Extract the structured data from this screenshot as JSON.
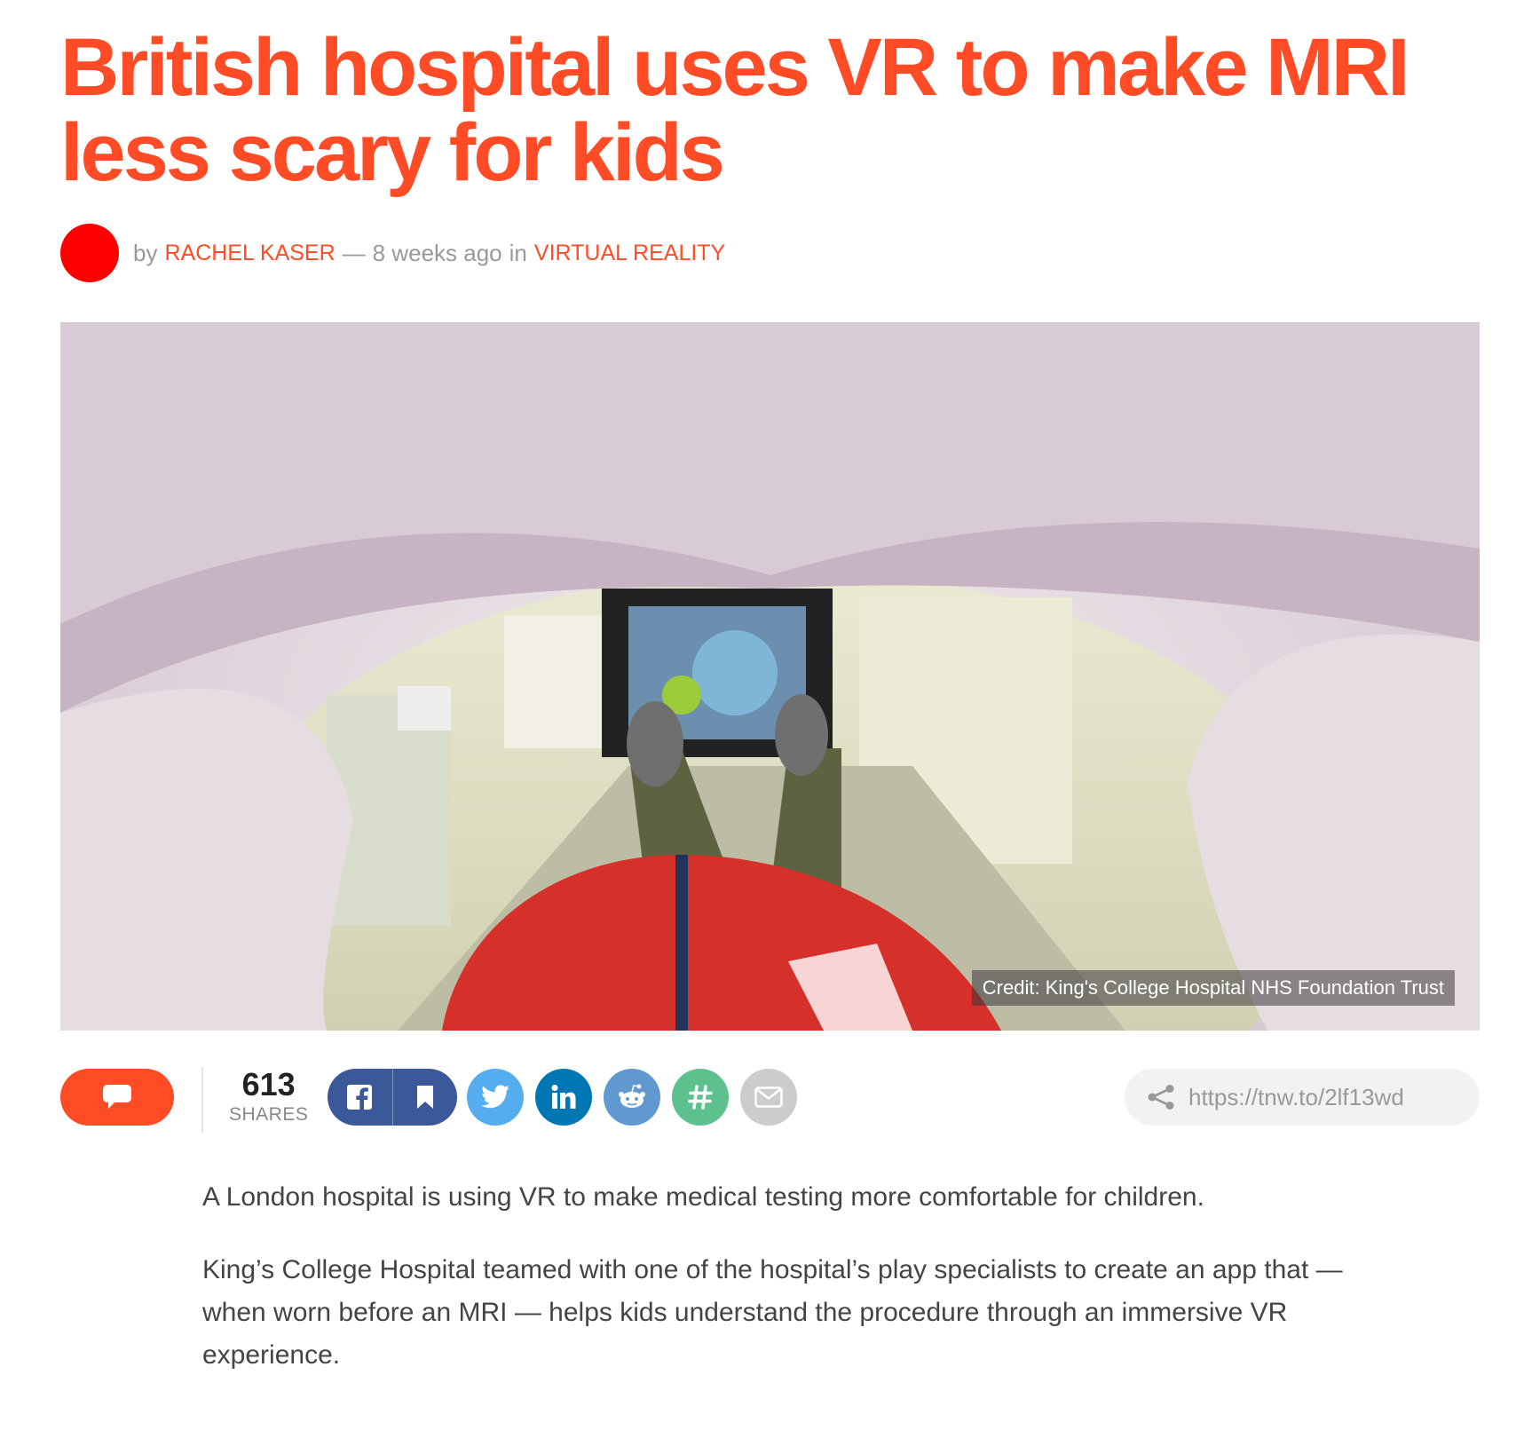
{
  "article": {
    "title": "British hospital uses VR to make MRI less scary for kids",
    "byline": {
      "prefix": "by",
      "author": "RACHEL KASER",
      "dash": "—",
      "time": "8 weeks ago",
      "in_word": "in",
      "category": "VIRTUAL REALITY"
    },
    "hero_image": {
      "alt_icon": "mri-scanner-photo",
      "credit": "Credit: King's College Hospital NHS Foundation Trust"
    },
    "paragraphs": [
      "A London hospital is using VR to make medical testing more comfortable for children.",
      "King’s College Hospital teamed with one of the hospital’s play specialists to create an app that — when worn before an MRI — helps kids understand the procedure through an immersive VR experience."
    ]
  },
  "share_bar": {
    "share_count": "613",
    "share_label": "SHARES",
    "short_url": "https://tnw.to/2lf13wd",
    "icons": [
      "comment-icon",
      "facebook-icon",
      "bookmark-icon",
      "twitter-icon",
      "linkedin-icon",
      "reddit-icon",
      "hashtag-icon",
      "email-icon",
      "share-icon"
    ]
  },
  "colors": {
    "accent": "#ff4c27",
    "facebook": "#3b5998",
    "twitter": "#55acee",
    "linkedin": "#0077b5",
    "reddit": "#5f99cf",
    "hashtag": "#5dc18e",
    "email": "#cccccc"
  }
}
